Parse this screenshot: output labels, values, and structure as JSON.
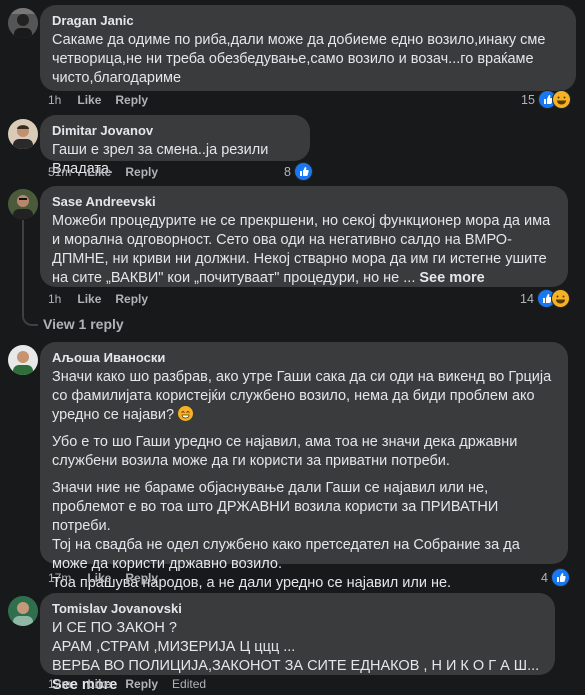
{
  "actions": {
    "like": "Like",
    "reply": "Reply",
    "see_more": "See more",
    "edited": "Edited"
  },
  "comments": [
    {
      "author": "Dragan Janic",
      "text": "Сакаме да одиме по риба,дали може да добиеме едно возило,инаку сме четворица,не ни треба обезбедување,само возило и возач...го враќаме чисто,благодариме",
      "time": "1h",
      "reactions_count": "15",
      "reaction_icons": [
        "like-icon",
        "haha-icon"
      ]
    },
    {
      "author": "Dimitar Jovanov",
      "text": "Гаши е зрел за смена..ја резили Владата.",
      "time": "51m",
      "reactions_count": "8",
      "reaction_icons": [
        "like-icon"
      ]
    },
    {
      "author": "Sase Andreevski",
      "text": "Можеби процедурите не се прекршени, но секој функционер мора да има и морална одговорност. Сето ова оди на негативно салдо на ВМРО-ДПМНЕ, ни криви ни должни. Некој стварно мора да им ги истегне ушите на сите „ВАКВИ\" кои „почитуваат\" процедури, но не ... ",
      "time": "1h",
      "reactions_count": "14",
      "reaction_icons": [
        "like-icon",
        "haha-icon"
      ],
      "view_replies": "View 1 reply"
    },
    {
      "author": "Аљоша Иваноски",
      "paragraphs": [
        "Значи како шо разбрав, ако утре Гаши сака да си оди на викенд во Грција со фамилијата користејќи службено возило, нема да биди проблем ако уредно се најави? ",
        "Убо е то шо Гаши уредно се најавил, ама тоа не значи дека државни службени возила може да ги користи за приватни потреби.",
        "Значи ние не бараме објаснување дали Гаши се најавил или не, проблемот е во тоа што ДРЖАВНИ возила користи за ПРИВАТНИ потреби.\nТој на свадба не одел службено како претседател на Собрание за да може да користи државно возило.\nТоа прашува народов, а не дали уредно се најавил или не."
      ],
      "time": "17m",
      "reactions_count": "4",
      "reaction_icons": [
        "like-icon"
      ]
    },
    {
      "author": "Tomislav Jovanovski",
      "text": "И СЕ ПО ЗАКОН ?\nАРАМ ,СТРАМ ,МИЗЕРИЈА Ц ццц ...\nВЕРБА ВО ПОЛИЦИЈА,ЗАКОНОТ ЗА СИТЕ ЕДНАКОВ , Н И К О Г А Ш... ",
      "time": "12m",
      "edited": true
    }
  ]
}
